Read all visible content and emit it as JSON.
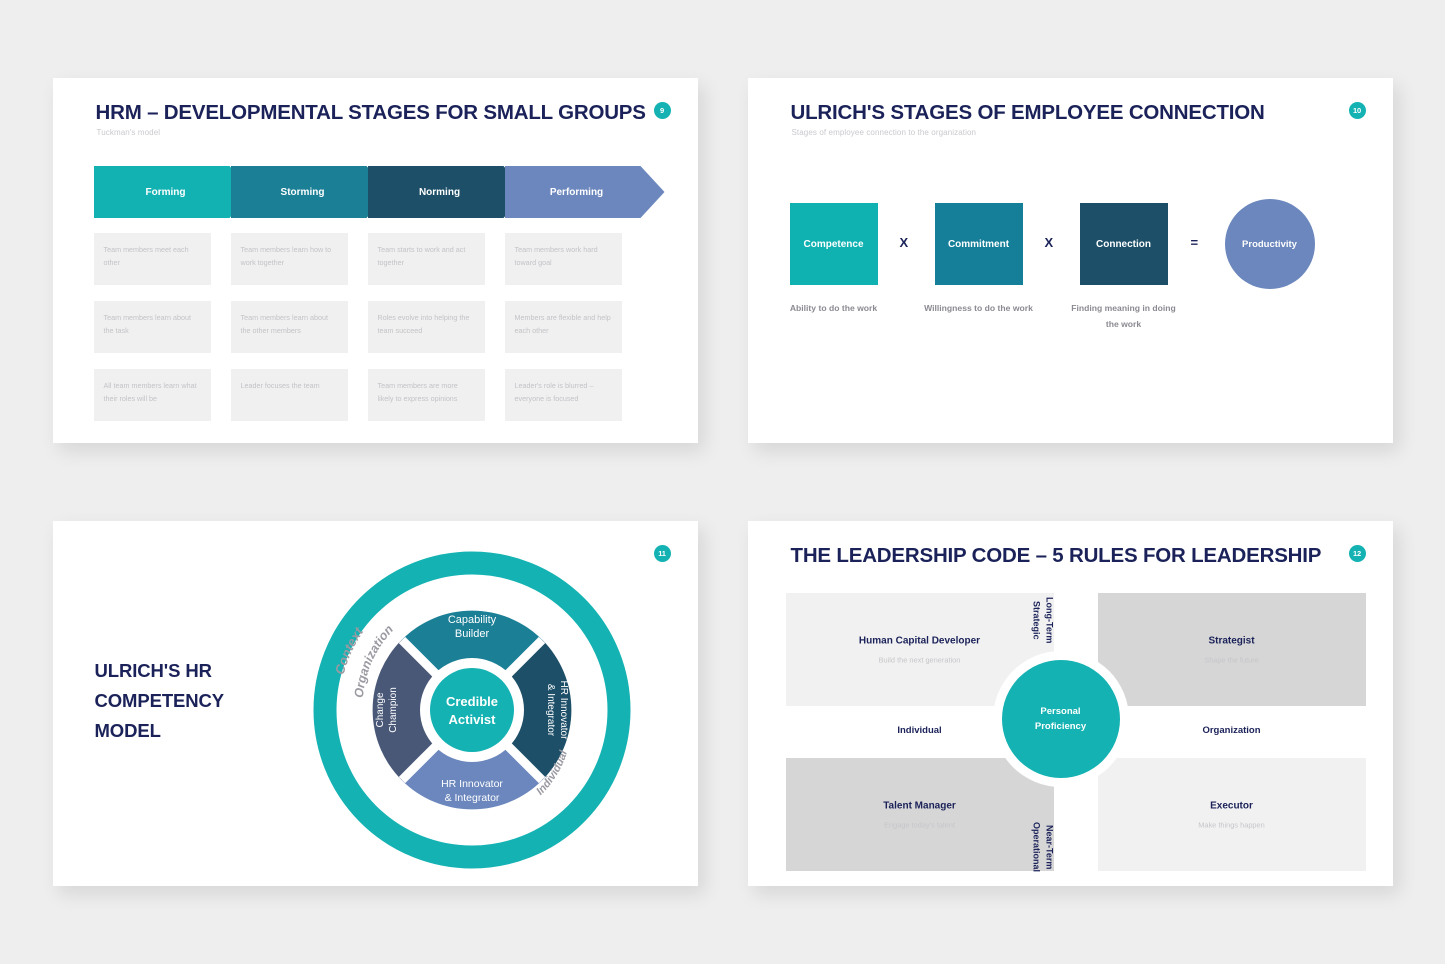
{
  "slides": [
    {
      "badge": "9",
      "title": "HRM – DEVELOPMENTAL STAGES FOR SMALL GROUPS",
      "subtitle": "Tuckman's model",
      "stages": [
        "Forming",
        "Storming",
        "Norming",
        "Performing"
      ],
      "cells": [
        "Team members meet each other",
        "Team members learn how to work together",
        "Team starts to work and act together",
        "Team members work hard toward goal",
        "Team members learn about the task",
        "Team members learn about the other members",
        "Roles evolve into helping the team succeed",
        "Members are flexible and help each other",
        "All team members learn what their roles will be",
        "Leader focuses the team",
        "Team members are more likely to express opinions",
        "Leader's role is blurred – everyone is focused"
      ]
    },
    {
      "badge": "10",
      "title": "ULRICH'S STAGES OF EMPLOYEE CONNECTION",
      "subtitle": "Stages of employee connection to the organization",
      "factors": [
        {
          "label": "Competence",
          "caption": "Ability to do the work",
          "color": "#0fb1b1"
        },
        {
          "label": "Commitment",
          "caption": "Willingness  to do the work",
          "color": "#157f99"
        },
        {
          "label": "Connection",
          "caption": "Finding meaning in doing the work",
          "color": "#1d4f68"
        }
      ],
      "operators": [
        "X",
        "X",
        "="
      ],
      "result": {
        "label": "Productivity",
        "color": "#6b87bd"
      }
    },
    {
      "badge": "11",
      "title": "ULRICH'S HR COMPETENCY MODEL",
      "donut": {
        "center": "Credible Activist",
        "outer_ring_labels": [
          "Context",
          "Organization",
          "Individual"
        ],
        "segments": [
          {
            "label": "Capability Builder",
            "color": "#1b7f96"
          },
          {
            "label": "HR Innovator & Integrator",
            "color": "#1d4f68"
          },
          {
            "label": "HR Innovator & Integrator",
            "color": "#6b87bd"
          },
          {
            "label": "Change Champion",
            "color": "#4a5878"
          }
        ],
        "ring_color": "#14b2b2",
        "core_color": "#14b2b2"
      }
    },
    {
      "badge": "12",
      "title": "THE LEADERSHIP CODE – 5 RULES FOR LEADERSHIP",
      "center": "Personal Proficiency",
      "quadrants": [
        {
          "title": "Human Capital Developer",
          "subtitle": "Build the next generation"
        },
        {
          "title": "Strategist",
          "subtitle": "Shape the future"
        },
        {
          "title": "Talent Manager",
          "subtitle": "Engage today's talent"
        },
        {
          "title": "Executor",
          "subtitle": "Make things happen"
        }
      ],
      "axes": {
        "left": "Individual",
        "right": "Organization",
        "top": "Long-Term Strategic",
        "bottom": "Near-Term Operational"
      }
    }
  ]
}
